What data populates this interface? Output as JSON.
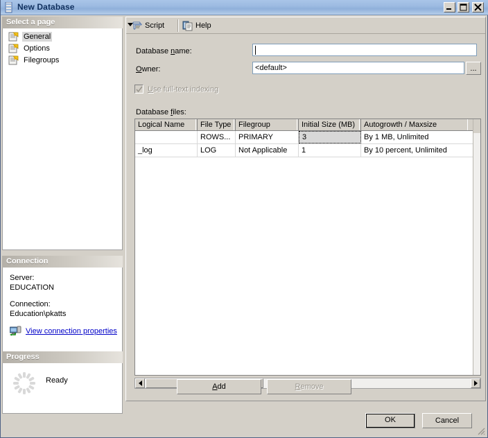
{
  "window": {
    "title": "New Database",
    "icon": "database-icon",
    "minimize_label": "Minimize",
    "maximize_label": "Maximize",
    "close_label": "Close"
  },
  "page_selector": {
    "header": "Select a page",
    "items": [
      {
        "label": "General",
        "icon": "page-icon",
        "selected": true
      },
      {
        "label": "Options",
        "icon": "page-icon",
        "selected": false
      },
      {
        "label": "Filegroups",
        "icon": "page-icon",
        "selected": false
      }
    ]
  },
  "connection": {
    "header": "Connection",
    "server_label": "Server:",
    "server_value": "EDUCATION",
    "connection_label": "Connection:",
    "connection_value": "Education\\pkatts",
    "link_text": "View connection properties",
    "link_icon": "connection-icon",
    "link_color": "#0000c8"
  },
  "progress": {
    "header": "Progress",
    "status": "Ready",
    "spinner_icon": "progress-spinner-icon"
  },
  "toolbar": {
    "script_label": "Script",
    "script_icon": "script-icon",
    "script_dropdown_icon": "chevron-down-icon",
    "help_label": "Help",
    "help_icon": "help-icon"
  },
  "form": {
    "database_name_label": "Database name:",
    "database_name_value": "",
    "owner_label": "Owner:",
    "owner_value": "<default>",
    "owner_browse_label": "...",
    "fulltext_label": "Use full-text indexing",
    "fulltext_checked": true,
    "fulltext_disabled": true,
    "database_files_label": "Database files:"
  },
  "grid": {
    "columns": [
      "Logical Name",
      "File Type",
      "Filegroup",
      "Initial Size (MB)",
      "Autogrowth / Maxsize"
    ],
    "rows": [
      {
        "logical_name": "",
        "file_type": "ROWS...",
        "filegroup": "PRIMARY",
        "initial_size": "3",
        "autogrowth": "By 1 MB, Unlimited",
        "selected_cell": 3
      },
      {
        "logical_name": "_log",
        "file_type": "LOG",
        "filegroup": "Not Applicable",
        "initial_size": "1",
        "autogrowth": "By 10 percent, Unlimited",
        "selected_cell": -1
      }
    ]
  },
  "actions": {
    "add_label": "Add",
    "remove_label": "Remove",
    "remove_disabled": true
  },
  "footer": {
    "ok_label": "OK",
    "cancel_label": "Cancel"
  },
  "colors": {
    "dialog_face": "#d4d0c8",
    "title_gradient_start": "#a9c5e8",
    "title_text": "#10305e",
    "link": "#0000c8",
    "disabled_text": "#9a968e"
  }
}
